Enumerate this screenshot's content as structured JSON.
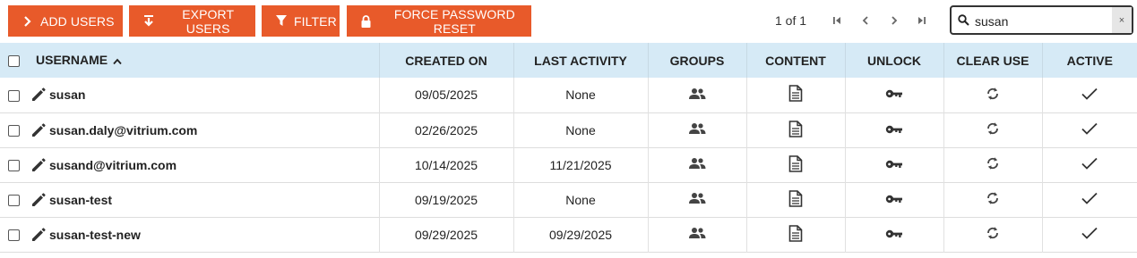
{
  "toolbar": {
    "add_users": "ADD USERS",
    "export_users": "EXPORT USERS",
    "filter": "FILTER",
    "force_reset": "FORCE PASSWORD RESET"
  },
  "pager": {
    "text": "1 of 1"
  },
  "search": {
    "value": "susan",
    "clear": "×"
  },
  "columns": {
    "username": "USERNAME",
    "created_on": "CREATED ON",
    "last_activity": "LAST ACTIVITY",
    "groups": "GROUPS",
    "content": "CONTENT",
    "unlock": "UNLOCK",
    "clear_use": "CLEAR USE",
    "active": "ACTIVE"
  },
  "rows": [
    {
      "username": "susan",
      "created_on": "09/05/2025",
      "last_activity": "None"
    },
    {
      "username": "susan.daly@vitrium.com",
      "created_on": "02/26/2025",
      "last_activity": "None"
    },
    {
      "username": "susand@vitrium.com",
      "created_on": "10/14/2025",
      "last_activity": "11/21/2025"
    },
    {
      "username": "susan-test",
      "created_on": "09/19/2025",
      "last_activity": "None"
    },
    {
      "username": "susan-test-new",
      "created_on": "09/29/2025",
      "last_activity": "09/29/2025"
    }
  ],
  "colors": {
    "accent": "#e85a2a",
    "header_bg": "#d6eaf6"
  }
}
